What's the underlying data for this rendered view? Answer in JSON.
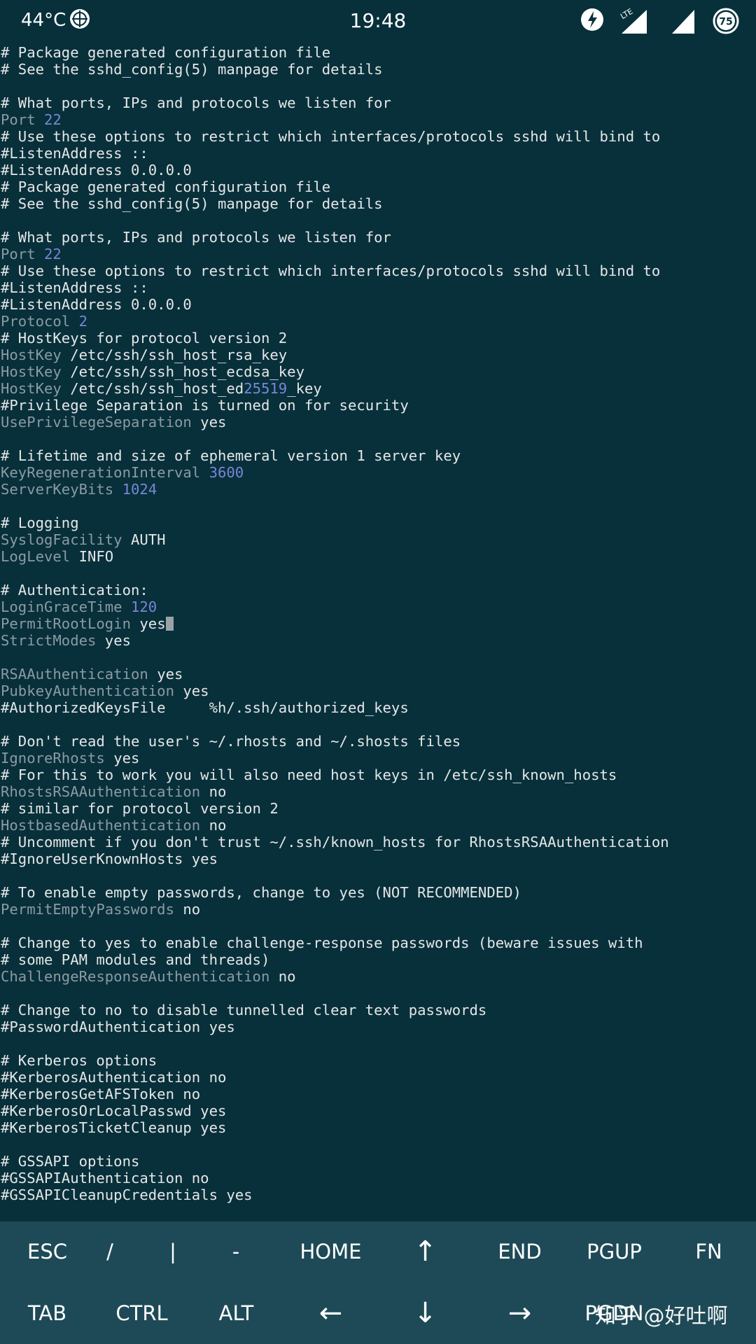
{
  "status_bar": {
    "temperature": "44°C",
    "time": "19:48",
    "battery_level": "75",
    "icons": [
      "weather-icon",
      "power-saving-icon",
      "lte-signal-icon",
      "wifi-signal-icon",
      "battery-icon"
    ]
  },
  "terminal": {
    "lines": [
      [
        {
          "c": "t",
          "s": "# Package generated configuration file"
        }
      ],
      [
        {
          "c": "t",
          "s": "# See the sshd_config(5) manpage for details"
        }
      ],
      [],
      [
        {
          "c": "t",
          "s": "# What ports, IPs and protocols we listen for"
        }
      ],
      [
        {
          "c": "k",
          "s": "Port "
        },
        {
          "c": "n",
          "s": "22"
        }
      ],
      [
        {
          "c": "t",
          "s": "# Use these options to restrict which interfaces/protocols sshd will bind to"
        }
      ],
      [
        {
          "c": "t",
          "s": "#ListenAddress ::"
        }
      ],
      [
        {
          "c": "t",
          "s": "#ListenAddress 0.0.0.0"
        }
      ],
      [
        {
          "c": "t",
          "s": "# Package generated configuration file"
        }
      ],
      [
        {
          "c": "t",
          "s": "# See the sshd_config(5) manpage for details"
        }
      ],
      [],
      [
        {
          "c": "t",
          "s": "# What ports, IPs and protocols we listen for"
        }
      ],
      [
        {
          "c": "k",
          "s": "Port "
        },
        {
          "c": "n",
          "s": "22"
        }
      ],
      [
        {
          "c": "t",
          "s": "# Use these options to restrict which interfaces/protocols sshd will bind to"
        }
      ],
      [
        {
          "c": "t",
          "s": "#ListenAddress ::"
        }
      ],
      [
        {
          "c": "t",
          "s": "#ListenAddress 0.0.0.0"
        }
      ],
      [
        {
          "c": "k",
          "s": "Protocol "
        },
        {
          "c": "n",
          "s": "2"
        }
      ],
      [
        {
          "c": "t",
          "s": "# HostKeys for protocol version 2"
        }
      ],
      [
        {
          "c": "k",
          "s": "HostKey "
        },
        {
          "c": "t",
          "s": "/etc/ssh/ssh_host_rsa_key"
        }
      ],
      [
        {
          "c": "k",
          "s": "HostKey "
        },
        {
          "c": "t",
          "s": "/etc/ssh/ssh_host_ecdsa_key"
        }
      ],
      [
        {
          "c": "k",
          "s": "HostKey "
        },
        {
          "c": "t",
          "s": "/etc/ssh/ssh_host_ed"
        },
        {
          "c": "n",
          "s": "25519"
        },
        {
          "c": "t",
          "s": "_key"
        }
      ],
      [
        {
          "c": "t",
          "s": "#Privilege Separation is turned on for security"
        }
      ],
      [
        {
          "c": "k",
          "s": "UsePrivilegeSeparation "
        },
        {
          "c": "t",
          "s": "yes"
        }
      ],
      [],
      [
        {
          "c": "t",
          "s": "# Lifetime and size of ephemeral version 1 server key"
        }
      ],
      [
        {
          "c": "k",
          "s": "KeyRegenerationInterval "
        },
        {
          "c": "n",
          "s": "3600"
        }
      ],
      [
        {
          "c": "k",
          "s": "ServerKeyBits "
        },
        {
          "c": "n",
          "s": "1024"
        }
      ],
      [],
      [
        {
          "c": "t",
          "s": "# Logging"
        }
      ],
      [
        {
          "c": "k",
          "s": "SyslogFacility "
        },
        {
          "c": "t",
          "s": "AUTH"
        }
      ],
      [
        {
          "c": "k",
          "s": "LogLevel "
        },
        {
          "c": "t",
          "s": "INFO"
        }
      ],
      [],
      [
        {
          "c": "t",
          "s": "# Authentication:"
        }
      ],
      [
        {
          "c": "k",
          "s": "LoginGraceTime "
        },
        {
          "c": "n",
          "s": "120"
        }
      ],
      [
        {
          "c": "k",
          "s": "PermitRootLogin "
        },
        {
          "c": "t",
          "s": "yes"
        },
        {
          "c": "cursor",
          "s": ""
        }
      ],
      [
        {
          "c": "k",
          "s": "StrictModes "
        },
        {
          "c": "t",
          "s": "yes"
        }
      ],
      [],
      [
        {
          "c": "k",
          "s": "RSAAuthentication "
        },
        {
          "c": "t",
          "s": "yes"
        }
      ],
      [
        {
          "c": "k",
          "s": "PubkeyAuthentication "
        },
        {
          "c": "t",
          "s": "yes"
        }
      ],
      [
        {
          "c": "t",
          "s": "#AuthorizedKeysFile     %h/.ssh/authorized_keys"
        }
      ],
      [],
      [
        {
          "c": "t",
          "s": "# Don't read the user's ~/.rhosts and ~/.shosts files"
        }
      ],
      [
        {
          "c": "k",
          "s": "IgnoreRhosts "
        },
        {
          "c": "t",
          "s": "yes"
        }
      ],
      [
        {
          "c": "t",
          "s": "# For this to work you will also need host keys in /etc/ssh_known_hosts"
        }
      ],
      [
        {
          "c": "k",
          "s": "RhostsRSAAuthentication "
        },
        {
          "c": "t",
          "s": "no"
        }
      ],
      [
        {
          "c": "t",
          "s": "# similar for protocol version 2"
        }
      ],
      [
        {
          "c": "k",
          "s": "HostbasedAuthentication "
        },
        {
          "c": "t",
          "s": "no"
        }
      ],
      [
        {
          "c": "t",
          "s": "# Uncomment if you don't trust ~/.ssh/known_hosts for RhostsRSAAuthentication"
        }
      ],
      [
        {
          "c": "t",
          "s": "#IgnoreUserKnownHosts yes"
        }
      ],
      [],
      [
        {
          "c": "t",
          "s": "# To enable empty passwords, change to yes (NOT RECOMMENDED)"
        }
      ],
      [
        {
          "c": "k",
          "s": "PermitEmptyPasswords "
        },
        {
          "c": "t",
          "s": "no"
        }
      ],
      [],
      [
        {
          "c": "t",
          "s": "# Change to yes to enable challenge-response passwords (beware issues with"
        }
      ],
      [
        {
          "c": "t",
          "s": "# some PAM modules and threads)"
        }
      ],
      [
        {
          "c": "k",
          "s": "ChallengeResponseAuthentication "
        },
        {
          "c": "t",
          "s": "no"
        }
      ],
      [],
      [
        {
          "c": "t",
          "s": "# Change to no to disable tunnelled clear text passwords"
        }
      ],
      [
        {
          "c": "t",
          "s": "#PasswordAuthentication yes"
        }
      ],
      [],
      [
        {
          "c": "t",
          "s": "# Kerberos options"
        }
      ],
      [
        {
          "c": "t",
          "s": "#KerberosAuthentication no"
        }
      ],
      [
        {
          "c": "t",
          "s": "#KerberosGetAFSToken no"
        }
      ],
      [
        {
          "c": "t",
          "s": "#KerberosOrLocalPasswd yes"
        }
      ],
      [
        {
          "c": "t",
          "s": "#KerberosTicketCleanup yes"
        }
      ],
      [],
      [
        {
          "c": "t",
          "s": "# GSSAPI options"
        }
      ],
      [
        {
          "c": "t",
          "s": "#GSSAPIAuthentication no"
        }
      ],
      [
        {
          "c": "t",
          "s": "#GSSAPICleanupCredentials yes"
        }
      ]
    ]
  },
  "extra_keys": {
    "row1": [
      "ESC",
      "/",
      "|",
      "-",
      "HOME",
      "↑",
      "END",
      "PGUP",
      "FN"
    ],
    "row2": [
      "TAB",
      "CTRL",
      "ALT",
      "←",
      "↓",
      "→",
      "PGDN"
    ]
  },
  "watermark": "知乎 @好吐啊",
  "colors": {
    "background": "#07303b",
    "keyword": "#8c9aa3",
    "number": "#7a86d6",
    "text": "#e6e6e6",
    "keys_background": "#1e4a57"
  }
}
